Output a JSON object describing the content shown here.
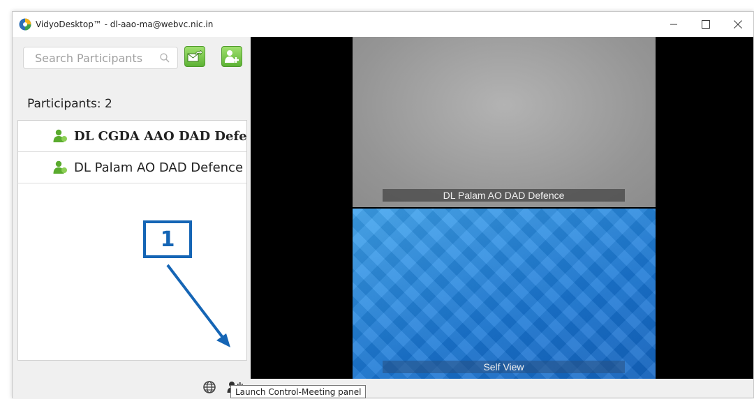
{
  "window": {
    "title": "VidyoDesktop™ - dl-aao-ma@webvc.nic.in",
    "icons": [
      "vidyo-app-icon",
      "minimize-icon",
      "maximize-icon",
      "close-icon"
    ]
  },
  "sidebar": {
    "search_placeholder": "Search Participants",
    "participants_label": "Participants: 2",
    "participants": [
      {
        "name": "DL CGDA AAO DAD Defence",
        "bold": true
      },
      {
        "name": "DL Palam AO DAD Defence",
        "bold": false
      }
    ],
    "bottom_icons": [
      "globe-icon",
      "control-meeting-icon"
    ]
  },
  "video": {
    "tiles": [
      {
        "label": "DL Palam AO DAD Defence"
      },
      {
        "label": "Self View"
      }
    ]
  },
  "annotation": {
    "number": "1"
  },
  "tooltip": {
    "text": "Launch Control-Meeting panel"
  },
  "colors": {
    "accent_green": "#5db235",
    "annotation_blue": "#1565b5",
    "self_view_blue": "#1a78d6"
  }
}
